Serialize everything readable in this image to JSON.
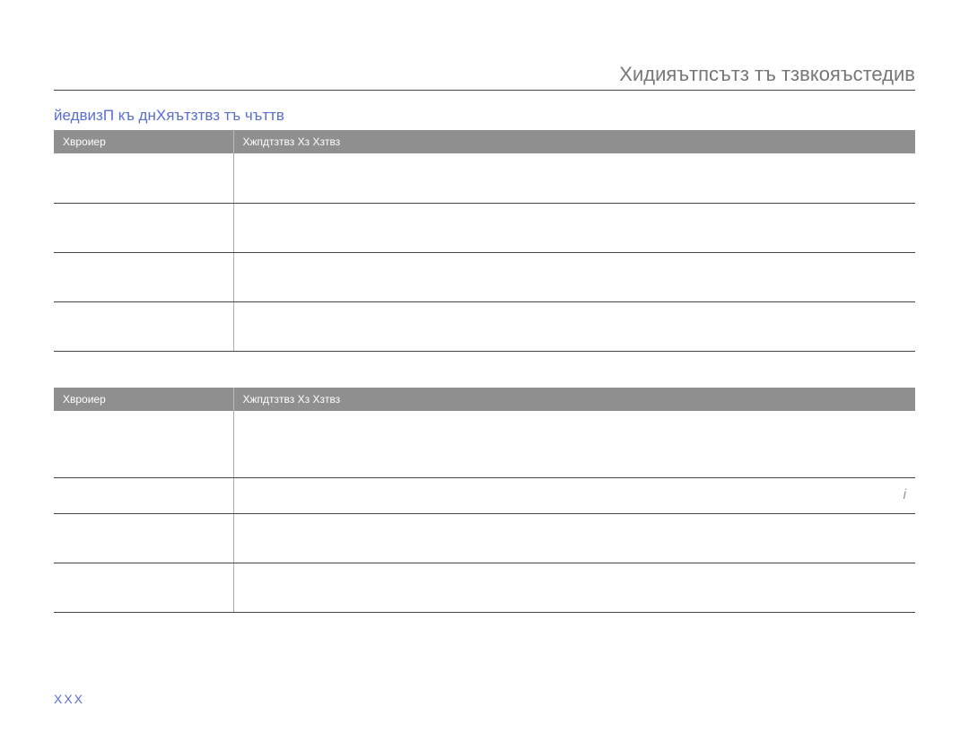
{
  "page": {
    "title": "Xидияътпсътз тъ тзвкояъстедив",
    "subtitle": "йедвизП къ днXяътзтвз тъ чъттв",
    "number": "XXX"
  },
  "table1": {
    "headers": [
      "Xвроиер",
      "Xжпдтзтвз Xз Xзтвз"
    ],
    "rows": [
      {
        "left": "",
        "right": ""
      },
      {
        "left": "",
        "right": ""
      },
      {
        "left": "",
        "right": ""
      },
      {
        "left": "",
        "right": ""
      }
    ]
  },
  "table2": {
    "headers": [
      "Xвроиер",
      "Xжпдтзтвз Xз Xзтвз"
    ],
    "rows": [
      {
        "left": "",
        "right": ""
      },
      {
        "left": "",
        "right": "i"
      },
      {
        "left": "",
        "right": ""
      },
      {
        "left": "",
        "right": ""
      }
    ]
  }
}
